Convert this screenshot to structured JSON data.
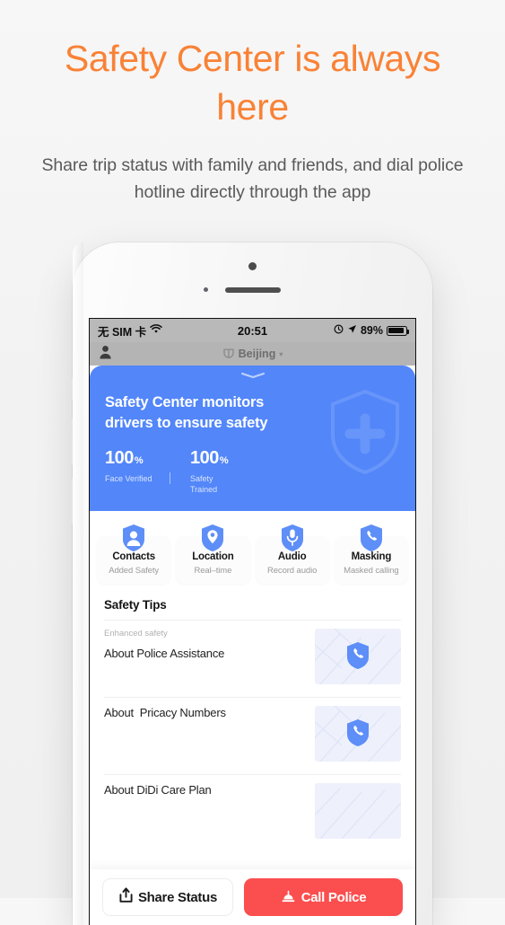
{
  "promo": {
    "title": "Safety Center is always here",
    "subtitle": "Share trip status with family and friends, and dial police hotline directly through the app",
    "accent_color": "#F98236",
    "text_color": "#5a5a5a"
  },
  "phone": {
    "status_bar": {
      "carrier": "无 SIM 卡",
      "wifi_icon": "wifi-icon",
      "time": "20:51",
      "alarm_icon": "alarm-icon",
      "location_icon": "location-arrow-icon",
      "battery_percent": "89%",
      "battery_level": 89
    },
    "nav_bar": {
      "profile_icon": "person-icon",
      "brand_icon": "brand-logo-icon",
      "city": "Beijing",
      "chevron_icon": "chevron-down-icon"
    }
  },
  "hero": {
    "title": "Safety Center monitors drivers to ensure safety",
    "background_color": "#5286F9",
    "watermark_icon": "shield-plus-icon",
    "handle_icon": "chevron-down-handle-icon",
    "stats": [
      {
        "value": "100",
        "unit": "%",
        "label": "Face Verified"
      },
      {
        "value": "100",
        "unit": "%",
        "label": "Safety\nTrained"
      }
    ]
  },
  "features": [
    {
      "icon": "shield-person-icon",
      "name": "Contacts",
      "desc": "Added Safety"
    },
    {
      "icon": "shield-pin-icon",
      "name": "Location",
      "desc": "Real–time"
    },
    {
      "icon": "shield-mic-icon",
      "name": "Audio",
      "desc": "Record audio"
    },
    {
      "icon": "shield-phone-icon",
      "name": "Masking",
      "desc": "Masked calling"
    }
  ],
  "tips": {
    "heading": "Safety Tips",
    "items": [
      {
        "kicker": "Enhanced safety",
        "title": "About Police Assistance",
        "thumb_icon": "shield-phone-icon"
      },
      {
        "kicker": "",
        "title": "About  Pricacy Numbers",
        "thumb_icon": "shield-phone-icon"
      },
      {
        "kicker": "",
        "title": "About DiDi Care Plan",
        "thumb_icon": "shield-phone-icon"
      }
    ]
  },
  "actions": {
    "share": {
      "label": "Share Status",
      "icon": "share-upload-icon"
    },
    "police": {
      "label": "Call Police",
      "icon": "siren-icon",
      "color": "#FB4E4E"
    }
  }
}
